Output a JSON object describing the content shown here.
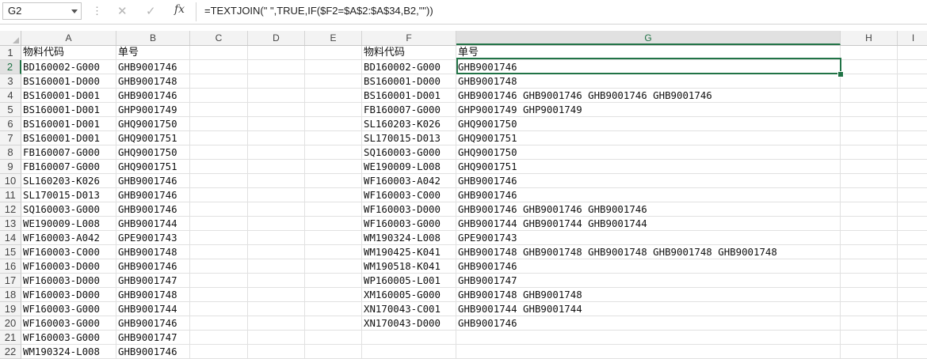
{
  "formula_bar": {
    "name_box": "G2",
    "formula": "=TEXTJOIN(\" \",TRUE,IF($F2=$A$2:$A$34,B2,\"\"))",
    "fx_label": "fx",
    "cancel_icon": "✕",
    "enter_icon": "✓",
    "dots": "⋮"
  },
  "columns": [
    {
      "key": "A",
      "label": "A"
    },
    {
      "key": "B",
      "label": "B"
    },
    {
      "key": "C",
      "label": "C"
    },
    {
      "key": "D",
      "label": "D"
    },
    {
      "key": "E",
      "label": "E"
    },
    {
      "key": "F",
      "label": "F"
    },
    {
      "key": "G",
      "label": "G"
    },
    {
      "key": "H",
      "label": "H"
    },
    {
      "key": "I",
      "label": "I"
    }
  ],
  "selected": {
    "column": "G",
    "row": "2"
  },
  "accent_color": "#217346",
  "rows": [
    {
      "num": "1",
      "A": "物料代码",
      "B": "单号",
      "F": "物料代码",
      "G": "单号"
    },
    {
      "num": "2",
      "A": "BD160002-G000",
      "B": "GHB9001746",
      "F": "BD160002-G000",
      "G": "GHB9001746"
    },
    {
      "num": "3",
      "A": "BS160001-D000",
      "B": "GHB9001748",
      "F": "BS160001-D000",
      "G": "GHB9001748"
    },
    {
      "num": "4",
      "A": "BS160001-D001",
      "B": "GHB9001746",
      "F": "BS160001-D001",
      "G": "GHB9001746 GHB9001746 GHB9001746 GHB9001746"
    },
    {
      "num": "5",
      "A": "BS160001-D001",
      "B": "GHP9001749",
      "F": "FB160007-G000",
      "G": "GHP9001749 GHP9001749"
    },
    {
      "num": "6",
      "A": "BS160001-D001",
      "B": "GHQ9001750",
      "F": "SL160203-K026",
      "G": "GHQ9001750"
    },
    {
      "num": "7",
      "A": "BS160001-D001",
      "B": "GHQ9001751",
      "F": "SL170015-D013",
      "G": "GHQ9001751"
    },
    {
      "num": "8",
      "A": "FB160007-G000",
      "B": "GHQ9001750",
      "F": "SQ160003-G000",
      "G": "GHQ9001750"
    },
    {
      "num": "9",
      "A": "FB160007-G000",
      "B": "GHQ9001751",
      "F": "WE190009-L008",
      "G": "GHQ9001751"
    },
    {
      "num": "10",
      "A": "SL160203-K026",
      "B": "GHB9001746",
      "F": "WF160003-A042",
      "G": "GHB9001746"
    },
    {
      "num": "11",
      "A": "SL170015-D013",
      "B": "GHB9001746",
      "F": "WF160003-C000",
      "G": "GHB9001746"
    },
    {
      "num": "12",
      "A": "SQ160003-G000",
      "B": "GHB9001746",
      "F": "WF160003-D000",
      "G": "GHB9001746 GHB9001746 GHB9001746"
    },
    {
      "num": "13",
      "A": "WE190009-L008",
      "B": "GHB9001744",
      "F": "WF160003-G000",
      "G": "GHB9001744 GHB9001744 GHB9001744"
    },
    {
      "num": "14",
      "A": "WF160003-A042",
      "B": "GPE9001743",
      "F": "WM190324-L008",
      "G": "GPE9001743"
    },
    {
      "num": "15",
      "A": "WF160003-C000",
      "B": "GHB9001748",
      "F": "WM190425-K041",
      "G": "GHB9001748 GHB9001748 GHB9001748 GHB9001748 GHB9001748"
    },
    {
      "num": "16",
      "A": "WF160003-D000",
      "B": "GHB9001746",
      "F": "WM190518-K041",
      "G": "GHB9001746"
    },
    {
      "num": "17",
      "A": "WF160003-D000",
      "B": "GHB9001747",
      "F": "WP160005-L001",
      "G": "GHB9001747"
    },
    {
      "num": "18",
      "A": "WF160003-D000",
      "B": "GHB9001748",
      "F": "XM160005-G000",
      "G": "GHB9001748 GHB9001748"
    },
    {
      "num": "19",
      "A": "WF160003-G000",
      "B": "GHB9001744",
      "F": "XN170043-C001",
      "G": "GHB9001744 GHB9001744"
    },
    {
      "num": "20",
      "A": "WF160003-G000",
      "B": "GHB9001746",
      "F": "XN170043-D000",
      "G": "GHB9001746"
    },
    {
      "num": "21",
      "A": "WF160003-G000",
      "B": "GHB9001747",
      "F": "",
      "G": ""
    },
    {
      "num": "22",
      "A": "WM190324-L008",
      "B": "GHB9001746",
      "F": "",
      "G": ""
    }
  ]
}
